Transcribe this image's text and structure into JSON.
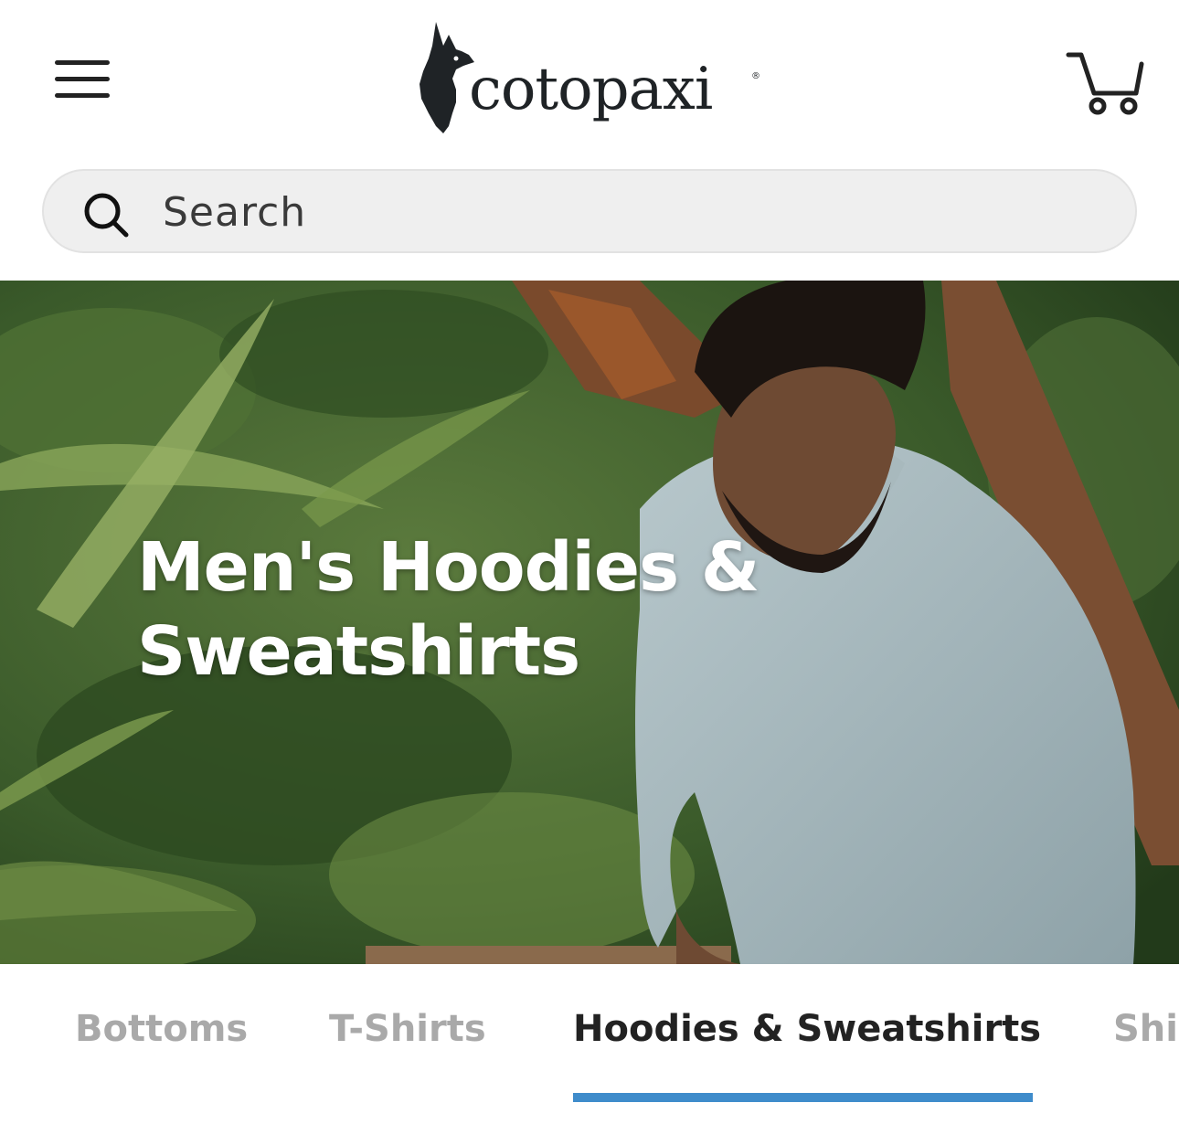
{
  "header": {
    "brand": "cotopaxi",
    "brand_mark": "®"
  },
  "search": {
    "placeholder": "Search"
  },
  "hero": {
    "title": "Men's Hoodies & Sweatshirts"
  },
  "tabs": [
    {
      "label": "Bottoms",
      "active": false
    },
    {
      "label": "T-Shirts",
      "active": false
    },
    {
      "label": "Hoodies & Sweatshirts",
      "active": true
    },
    {
      "label": "Shi",
      "active": false
    }
  ],
  "icons": {
    "menu": "menu-icon",
    "logo": "llama-logo-icon",
    "cart": "cart-icon",
    "search": "search-icon"
  },
  "colors": {
    "active_tab_underline": "#3f8ccb",
    "inactive_tab_text": "#a9a9a9",
    "active_tab_text": "#222222",
    "search_bg": "#efefef"
  }
}
